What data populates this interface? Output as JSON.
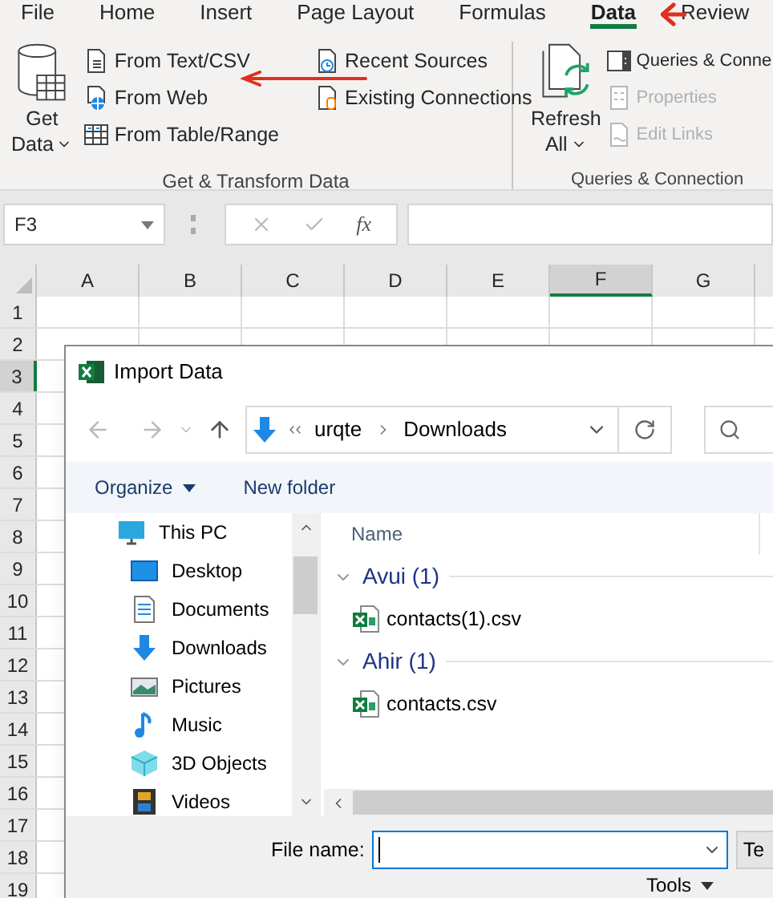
{
  "ribbon_tabs": [
    {
      "label": "File",
      "selected": false
    },
    {
      "label": "Home",
      "selected": false
    },
    {
      "label": "Insert",
      "selected": false
    },
    {
      "label": "Page Layout",
      "selected": false
    },
    {
      "label": "Formulas",
      "selected": false
    },
    {
      "label": "Data",
      "selected": true
    },
    {
      "label": "Review",
      "selected": false
    }
  ],
  "ribbon_groups": [
    {
      "label": "Get & Transform Data",
      "big_button": {
        "lines": [
          "Get",
          "Data"
        ]
      },
      "columns": [
        [
          {
            "label": "From Text/CSV",
            "disabled": false
          },
          {
            "label": "From Web",
            "disabled": false
          },
          {
            "label": "From Table/Range",
            "disabled": false
          }
        ],
        [
          {
            "label": "Recent Sources",
            "disabled": false
          },
          {
            "label": "Existing Connections",
            "disabled": false
          }
        ]
      ]
    },
    {
      "label": "Queries & Connection",
      "big_button": {
        "lines": [
          "Refresh",
          "All"
        ]
      },
      "columns": [
        [
          {
            "label": "Queries & Conne",
            "disabled": false
          },
          {
            "label": "Properties",
            "disabled": true
          },
          {
            "label": "Edit Links",
            "disabled": true
          }
        ]
      ]
    }
  ],
  "formula_bar": {
    "name_box": "F3",
    "function_label": "fx"
  },
  "grid": {
    "columns": [
      {
        "label": "A",
        "selected": false
      },
      {
        "label": "B",
        "selected": false
      },
      {
        "label": "C",
        "selected": false
      },
      {
        "label": "D",
        "selected": false
      },
      {
        "label": "E",
        "selected": false
      },
      {
        "label": "F",
        "selected": true
      },
      {
        "label": "G",
        "selected": false
      }
    ],
    "rows": [
      {
        "label": "1",
        "selected": false
      },
      {
        "label": "2",
        "selected": false
      },
      {
        "label": "3",
        "selected": true
      },
      {
        "label": "4",
        "selected": false
      },
      {
        "label": "5",
        "selected": false
      },
      {
        "label": "6",
        "selected": false
      },
      {
        "label": "7",
        "selected": false
      },
      {
        "label": "8",
        "selected": false
      },
      {
        "label": "9",
        "selected": false
      },
      {
        "label": "10",
        "selected": false
      },
      {
        "label": "11",
        "selected": false
      },
      {
        "label": "12",
        "selected": false
      },
      {
        "label": "13",
        "selected": false
      },
      {
        "label": "14",
        "selected": false
      },
      {
        "label": "15",
        "selected": false
      },
      {
        "label": "16",
        "selected": false
      },
      {
        "label": "17",
        "selected": false
      },
      {
        "label": "18",
        "selected": false
      },
      {
        "label": "19",
        "selected": false
      }
    ]
  },
  "dialog": {
    "title": "Import Data",
    "path": [
      "urqte",
      "Downloads"
    ],
    "commands": [
      {
        "label": "Organize",
        "dropdown": true
      },
      {
        "label": "New folder",
        "dropdown": false
      }
    ],
    "nav": [
      {
        "label": "This PC",
        "children": [
          {
            "label": "Desktop"
          },
          {
            "label": "Documents"
          },
          {
            "label": "Downloads"
          },
          {
            "label": "Pictures"
          },
          {
            "label": "Music"
          },
          {
            "label": "3D Objects"
          },
          {
            "label": "Videos"
          }
        ]
      }
    ],
    "files": {
      "column": "Name",
      "groups": [
        {
          "label": "Avui (1)",
          "expanded": true,
          "files": [
            {
              "name": "contacts(1).csv"
            }
          ]
        },
        {
          "label": "Ahir (1)",
          "expanded": true,
          "files": [
            {
              "name": "contacts.csv"
            }
          ]
        }
      ]
    },
    "file_name_label": "File name:",
    "file_type_button": "Te",
    "tools_button": "Tools"
  }
}
